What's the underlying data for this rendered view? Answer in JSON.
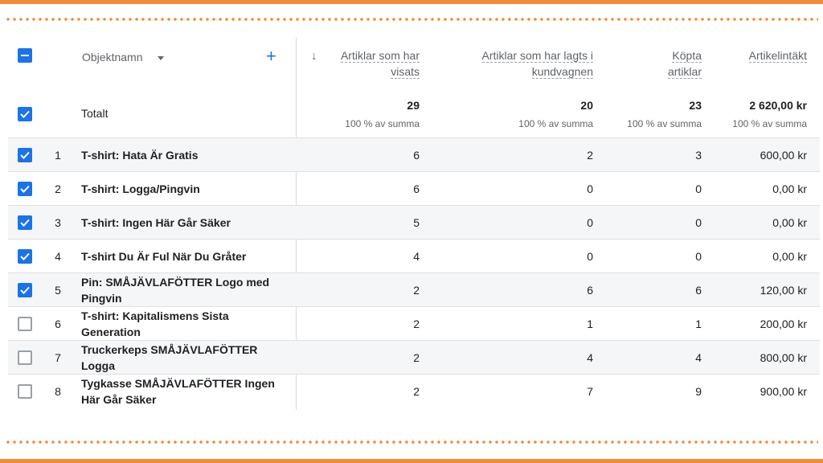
{
  "header": {
    "object_name_label": "Objektnamn",
    "columns": [
      {
        "line1": "Artiklar som har",
        "line2": "visats"
      },
      {
        "line1": "Artiklar som har lagts i",
        "line2": "kundvagnen"
      },
      {
        "line1": "Köpta",
        "line2": "artiklar"
      },
      {
        "line1": "Artikelintäkt",
        "line2": ""
      }
    ]
  },
  "totals": {
    "label": "Totalt",
    "values": [
      "29",
      "20",
      "23",
      "2 620,00 kr"
    ],
    "sub": "100 % av summa"
  },
  "rows": [
    {
      "index": "1",
      "name1": "T-shirt: Hata Är Gratis",
      "name2": "",
      "checked": true,
      "v": [
        "6",
        "2",
        "3",
        "600,00 kr"
      ]
    },
    {
      "index": "2",
      "name1": "T-shirt: Logga/Pingvin",
      "name2": "",
      "checked": true,
      "v": [
        "6",
        "0",
        "0",
        "0,00 kr"
      ]
    },
    {
      "index": "3",
      "name1": "T-shirt: Ingen Här Går Säker",
      "name2": "",
      "checked": true,
      "v": [
        "5",
        "0",
        "0",
        "0,00 kr"
      ]
    },
    {
      "index": "4",
      "name1": "T-shirt Du Är Ful När Du Gråter",
      "name2": "",
      "checked": true,
      "v": [
        "4",
        "0",
        "0",
        "0,00 kr"
      ]
    },
    {
      "index": "5",
      "name1": "Pin: SMÅJÄVLAFÖTTER Logo med",
      "name2": "Pingvin",
      "checked": true,
      "v": [
        "2",
        "6",
        "6",
        "120,00 kr"
      ]
    },
    {
      "index": "6",
      "name1": "T-shirt: Kapitalismens Sista",
      "name2": "Generation",
      "checked": false,
      "v": [
        "2",
        "1",
        "1",
        "200,00 kr"
      ]
    },
    {
      "index": "7",
      "name1": "Truckerkeps SMÅJÄVLAFÖTTER",
      "name2": "Logga",
      "checked": false,
      "v": [
        "2",
        "4",
        "4",
        "800,00 kr"
      ]
    },
    {
      "index": "8",
      "name1": "Tygkasse SMÅJÄVLAFÖTTER Ingen",
      "name2": "Här Går Säker",
      "checked": false,
      "v": [
        "2",
        "7",
        "9",
        "900,00 kr"
      ]
    }
  ],
  "colors": {
    "accent": "#1a73e8",
    "frame": "#f28c38"
  },
  "icons": {
    "select_all": "minus-checkbox-icon",
    "add": "plus-icon",
    "sort": "arrow-down-icon",
    "dropdown": "caret-down-icon"
  }
}
